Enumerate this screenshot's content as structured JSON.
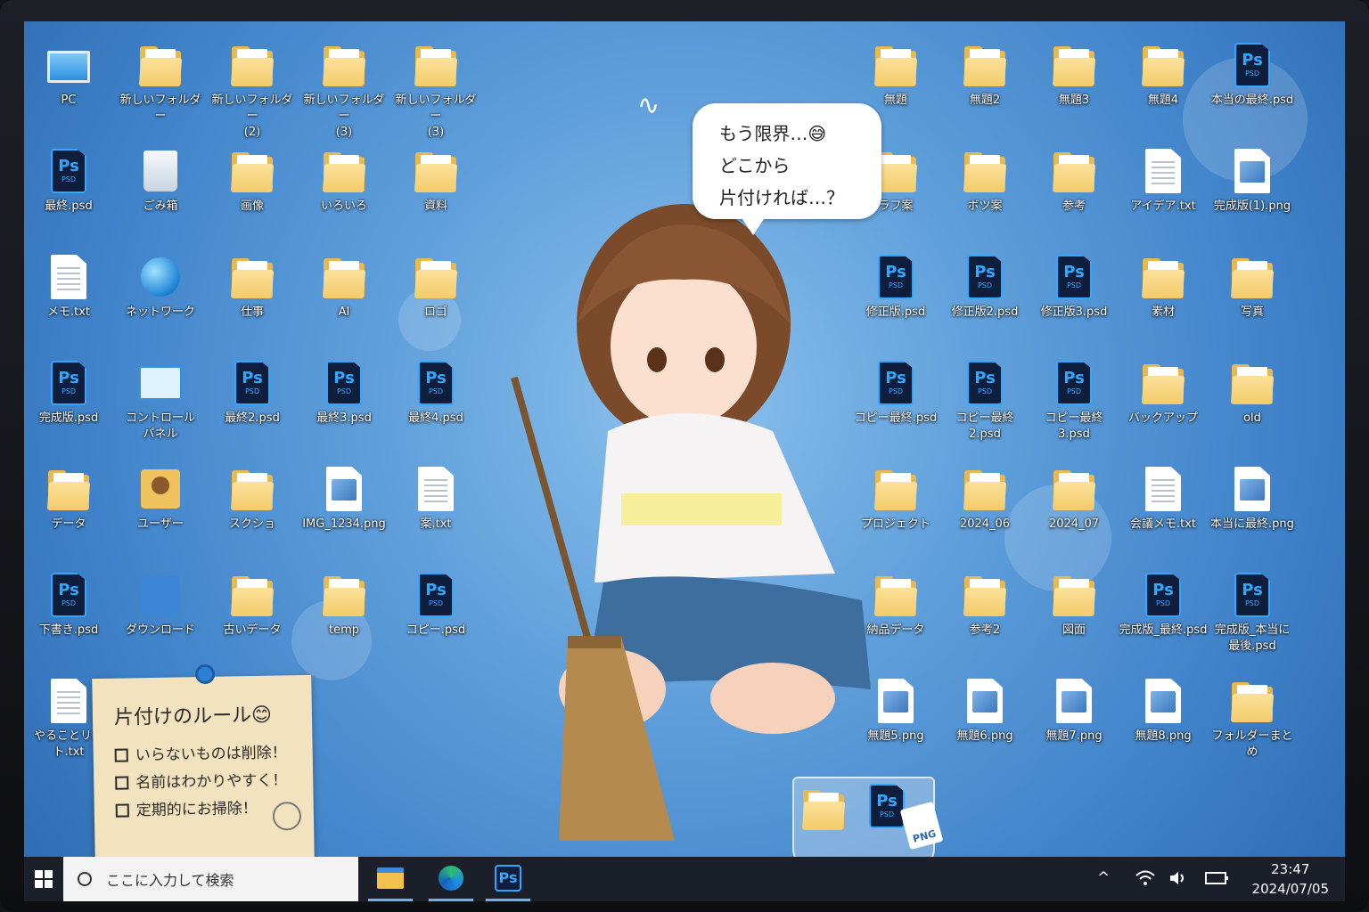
{
  "speech_bubble": {
    "line1": "もう限界…😅",
    "line2": "どこから",
    "line3": "片付ければ…？"
  },
  "note": {
    "title": "片付けのルール😊",
    "items": [
      "いらないものは削除！",
      "名前はわかりやすく！",
      "定期的にお掃除！"
    ]
  },
  "desktop_left": [
    {
      "label": "PC",
      "type": "pc"
    },
    {
      "label": "新しいフォルダー",
      "type": "folder"
    },
    {
      "label": "新しいフォルダー\n(2)",
      "type": "folder"
    },
    {
      "label": "新しいフォルダー\n(3)",
      "type": "folder"
    },
    {
      "label": "新しいフォルダー\n(3)",
      "type": "folder"
    },
    {
      "label": "最終.psd",
      "type": "psd"
    },
    {
      "label": "ごみ箱",
      "type": "bin"
    },
    {
      "label": "画像",
      "type": "folder"
    },
    {
      "label": "いろいろ",
      "type": "folder"
    },
    {
      "label": "資料",
      "type": "folder"
    },
    {
      "label": "メモ.txt",
      "type": "txt"
    },
    {
      "label": "ネットワーク",
      "type": "globe"
    },
    {
      "label": "仕事",
      "type": "folder"
    },
    {
      "label": "AI",
      "type": "folder"
    },
    {
      "label": "ロゴ",
      "type": "folder"
    },
    {
      "label": "完成版.psd",
      "type": "psd"
    },
    {
      "label": "コントロール\nパネル",
      "type": "panel"
    },
    {
      "label": "最終2.psd",
      "type": "psd"
    },
    {
      "label": "最終3.psd",
      "type": "psd"
    },
    {
      "label": "最終4.psd",
      "type": "psd"
    },
    {
      "label": "データ",
      "type": "folder"
    },
    {
      "label": "ユーザー",
      "type": "user"
    },
    {
      "label": "スクショ",
      "type": "folder"
    },
    {
      "label": "IMG_1234.png",
      "type": "png"
    },
    {
      "label": "案.txt",
      "type": "txt"
    },
    {
      "label": "下書き.psd",
      "type": "psd"
    },
    {
      "label": "ダウンロード",
      "type": "dl"
    },
    {
      "label": "古いデータ",
      "type": "folder"
    },
    {
      "label": "temp",
      "type": "folder"
    },
    {
      "label": "コピー.psd",
      "type": "psd"
    },
    {
      "label": "やることリスト.txt",
      "type": "txt"
    }
  ],
  "desktop_right": [
    {
      "label": "無題",
      "type": "folder"
    },
    {
      "label": "無題2",
      "type": "folder"
    },
    {
      "label": "無題3",
      "type": "folder"
    },
    {
      "label": "無題4",
      "type": "folder"
    },
    {
      "label": "本当の最終.psd",
      "type": "psd"
    },
    {
      "label": "ラフ案",
      "type": "folder"
    },
    {
      "label": "ボツ案",
      "type": "folder"
    },
    {
      "label": "参考",
      "type": "folder"
    },
    {
      "label": "アイデア.txt",
      "type": "txt"
    },
    {
      "label": "完成版(1).png",
      "type": "png"
    },
    {
      "label": "修正版.psd",
      "type": "psd"
    },
    {
      "label": "修正版2.psd",
      "type": "psd"
    },
    {
      "label": "修正版3.psd",
      "type": "psd"
    },
    {
      "label": "素材",
      "type": "folder"
    },
    {
      "label": "写真",
      "type": "folder"
    },
    {
      "label": "コピー最終.psd",
      "type": "psd"
    },
    {
      "label": "コピー最終2.psd",
      "type": "psd"
    },
    {
      "label": "コピー最終3.psd",
      "type": "psd"
    },
    {
      "label": "バックアップ",
      "type": "folder"
    },
    {
      "label": "old",
      "type": "folder"
    },
    {
      "label": "プロジェクト",
      "type": "folder"
    },
    {
      "label": "2024_06",
      "type": "folder"
    },
    {
      "label": "2024_07",
      "type": "folder"
    },
    {
      "label": "会議メモ.txt",
      "type": "txt"
    },
    {
      "label": "本当に最終.png",
      "type": "png"
    },
    {
      "label": "納品データ",
      "type": "folder"
    },
    {
      "label": "参考2",
      "type": "folder"
    },
    {
      "label": "図面",
      "type": "folder"
    },
    {
      "label": "完成版_最終.psd",
      "type": "psd"
    },
    {
      "label": "完成版_本当に\n最後.psd",
      "type": "psd"
    },
    {
      "label": "無題5.png",
      "type": "png"
    },
    {
      "label": "無題6.png",
      "type": "png"
    },
    {
      "label": "無題7.png",
      "type": "png"
    },
    {
      "label": "無題8.png",
      "type": "png"
    },
    {
      "label": "フォルダーまとめ",
      "type": "folder"
    }
  ],
  "psd_glyph": {
    "big": "Ps",
    "small": "PSD"
  },
  "trash_png_label": "PNG",
  "taskbar": {
    "search_placeholder": "ここに入力して検索",
    "apps": [
      {
        "name": "file-explorer"
      },
      {
        "name": "edge"
      },
      {
        "name": "Ps"
      }
    ],
    "tray": {
      "chevron": "^",
      "wifi": "wifi",
      "volume": "volume",
      "battery": "battery"
    },
    "time": "23:47",
    "date": "2024/07/05"
  },
  "colors": {
    "desktop": "#5f9fdb",
    "taskbar": "#1a1f29",
    "psd_accent": "#31a8ff",
    "folder": "#f3cb6a"
  }
}
